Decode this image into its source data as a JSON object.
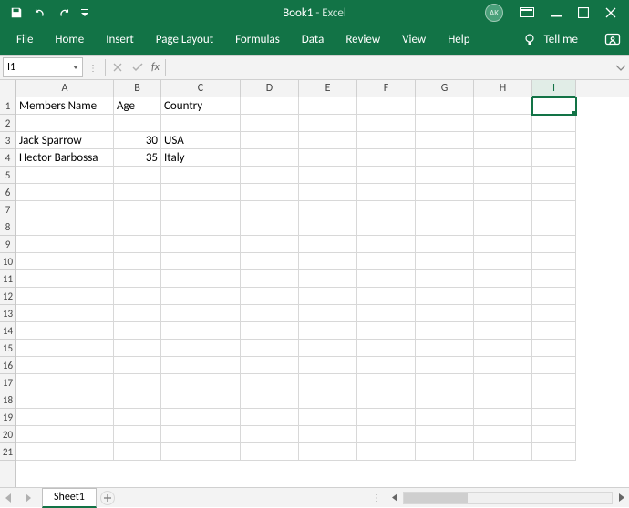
{
  "titlebar": {
    "book": "Book1",
    "sep": "  -  ",
    "app": "Excel",
    "avatar_initials": "AK"
  },
  "ribbon": {
    "tabs": [
      "File",
      "Home",
      "Insert",
      "Page Layout",
      "Formulas",
      "Data",
      "Review",
      "View",
      "Help"
    ],
    "tellme": "Tell me"
  },
  "formula_bar": {
    "name_box": "I1",
    "fx_label": "fx"
  },
  "grid": {
    "columns": [
      "A",
      "B",
      "C",
      "D",
      "E",
      "F",
      "G",
      "H",
      "I"
    ],
    "selected_col_index": 8,
    "row_count": 21,
    "selected_cell": "I1",
    "data": {
      "1": {
        "A": "Members Name",
        "B": "Age",
        "C": "Country"
      },
      "3": {
        "A": "Jack Sparrow",
        "B": "30",
        "C": "USA"
      },
      "4": {
        "A": "Hector Barbossa",
        "B": "35",
        "C": "Italy"
      }
    }
  },
  "sheetbar": {
    "active_sheet": "Sheet1"
  }
}
